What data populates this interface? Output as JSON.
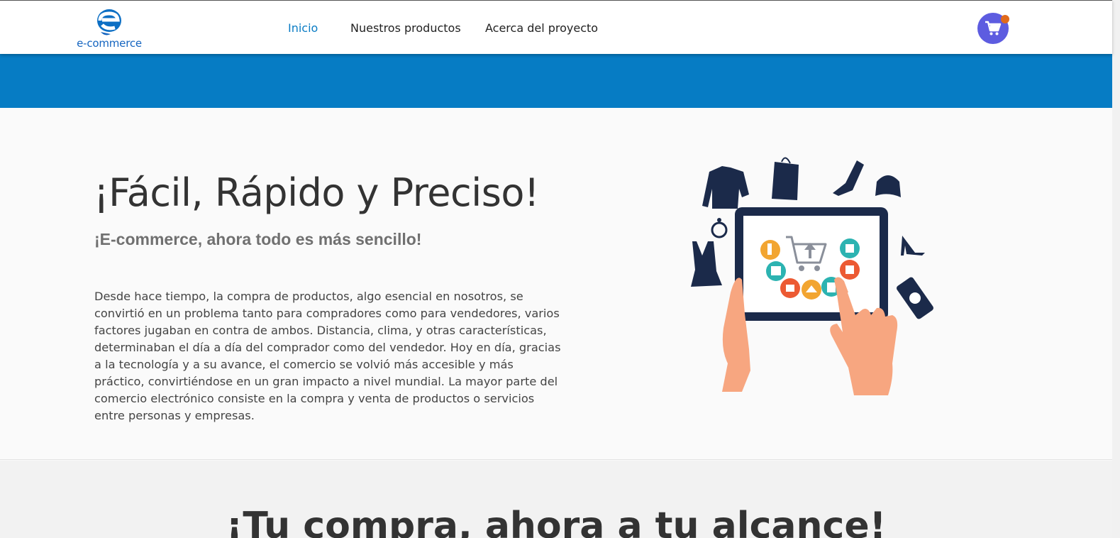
{
  "nav": {
    "logo_text": "e-commerce",
    "links": [
      {
        "label": "Inicio",
        "active": true
      },
      {
        "label": "Nuestros productos",
        "active": false
      },
      {
        "label": "Acerca del proyecto",
        "active": false
      }
    ],
    "cart_icon": "shopping-cart-icon"
  },
  "hero": {
    "title": "¡Fácil, Rápido y Preciso!",
    "subtitle": "¡E-commerce, ahora todo es más sencillo!",
    "description": "Desde hace tiempo, la compra de productos, algo esencial en nosotros, se convirtió en un problema tanto para compradores como para vendedores, varios factores jugaban en contra de ambos. Distancia, clima, y otras características, determinaban el día a día del comprador como del vendedor. Hoy en día, gracias a la tecnología y a su avance, el comercio se volvió más accesible y más práctico, convirtiéndose en un gran impacto a nivel mundial. La mayor parte del comercio electrónico consiste en la compra y venta de productos o servicios entre personas y empresas."
  },
  "section2": {
    "title": "¡Tu compra, ahora a tu alcance!"
  },
  "colors": {
    "banner": "#067cc4",
    "active_link": "#0a7cc4",
    "cart_button": "#5d5ce0",
    "cart_badge": "#e06a1c"
  }
}
